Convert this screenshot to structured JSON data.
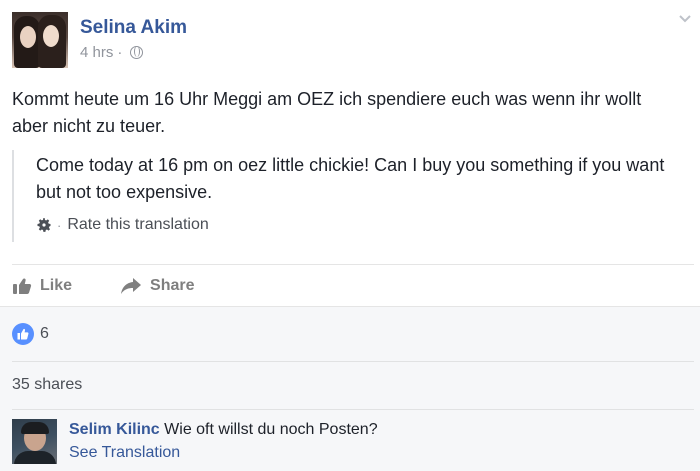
{
  "post": {
    "author": "Selina Akim",
    "time": "4 hrs",
    "time_separator": "·",
    "body": "Kommt heute um 16 Uhr Meggi am OEZ ich spendiere euch was wenn ihr wollt aber nicht zu teuer.",
    "translation": "Come today at 16 pm on oez little chickie! Can I buy you something if you want but not too expensive.",
    "rate_separator": "·",
    "rate_label": "Rate this translation",
    "icons": {
      "avatar": "profile-photo",
      "privacy": "globe-icon",
      "menu": "chevron-down-icon",
      "rate": "gear-icon"
    }
  },
  "actions": {
    "like": "Like",
    "share": "Share"
  },
  "footer": {
    "reaction_count": "6",
    "shares": "35 shares",
    "colors": {
      "like_badge": "#5890ff",
      "link": "#365899",
      "footer_bg": "#f6f7f9"
    }
  },
  "comment": {
    "author": "Selim Kilinc",
    "text": "Wie oft willst du noch Posten?",
    "see_translation": "See Translation"
  }
}
